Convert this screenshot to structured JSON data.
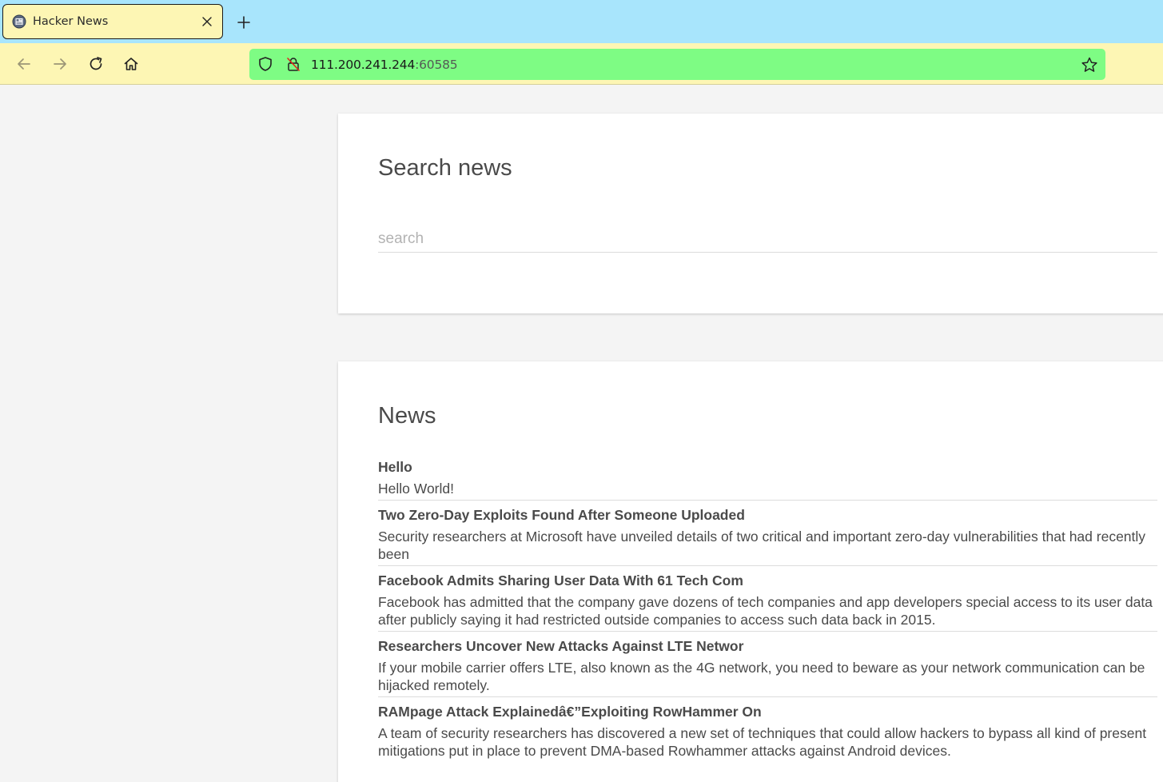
{
  "browser": {
    "tab": {
      "title": "Hacker News"
    },
    "url": {
      "host": "111.200.241.244",
      "port": ":60585"
    }
  },
  "search": {
    "heading": "Search news",
    "placeholder": "search"
  },
  "news": {
    "heading": "News",
    "items": [
      {
        "title": "Hello",
        "body": "Hello World!"
      },
      {
        "title": "Two Zero-Day Exploits Found After Someone Uploaded",
        "body": "Security researchers at Microsoft have unveiled details of two critical and important zero-day vulnerabilities that had recently been"
      },
      {
        "title": "Facebook Admits Sharing User Data With 61 Tech Com",
        "body": "Facebook has admitted that the company gave dozens of tech companies and app developers special access to its user data after publicly saying it had restricted outside companies to access such data back in 2015."
      },
      {
        "title": "Researchers Uncover New Attacks Against LTE Networ",
        "body": "If your mobile carrier offers LTE, also known as the 4G network, you need to beware as your network communication can be hijacked remotely."
      },
      {
        "title": "RAMpage Attack Explainedâ€”Exploiting RowHammer On",
        "body": "A team of security researchers has discovered a new set of techniques that could allow hackers to bypass all kind of present mitigations put in place to prevent DMA-based Rowhammer attacks against Android devices."
      }
    ]
  }
}
